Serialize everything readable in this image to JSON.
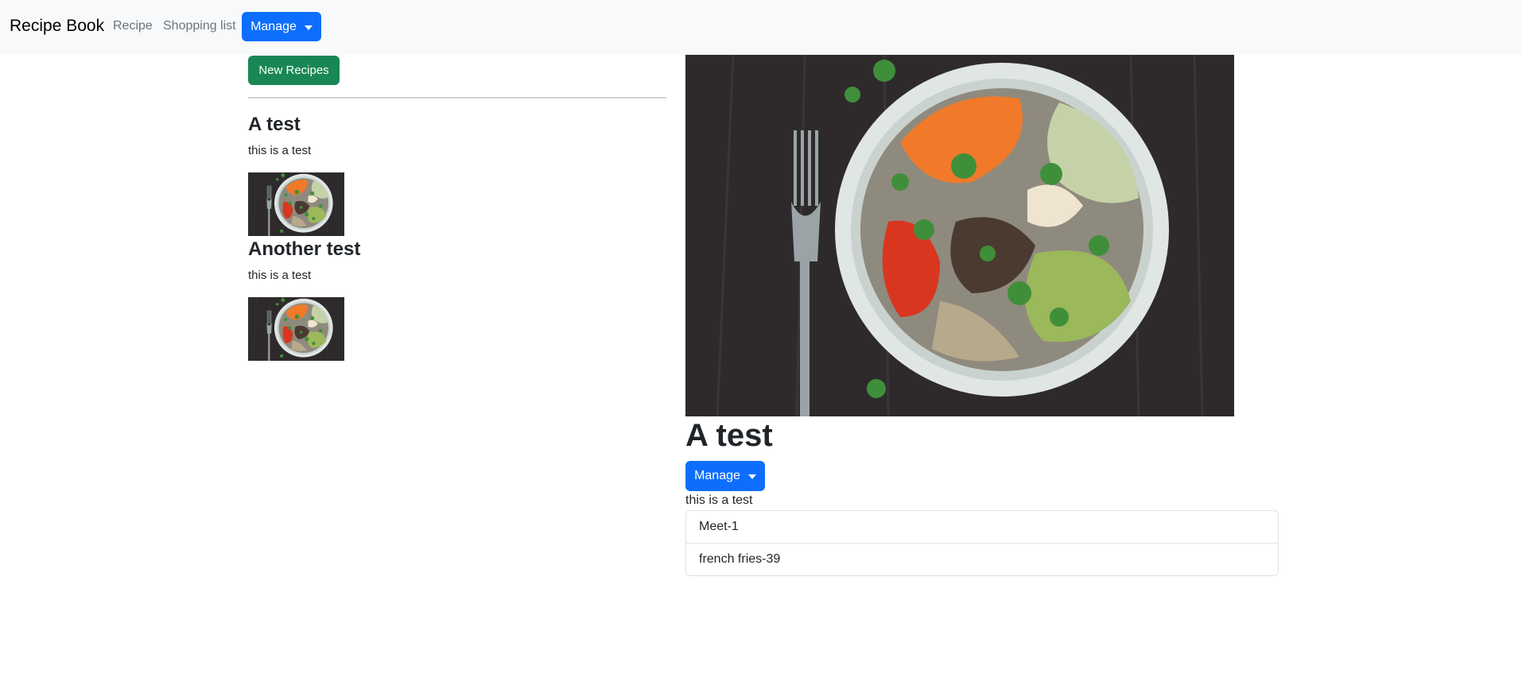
{
  "navbar": {
    "brand": "Recipe Book",
    "links": [
      "Recipe",
      "Shopping list"
    ],
    "manage_label": "Manage"
  },
  "recipe_list": {
    "new_button_label": "New Recipes",
    "items": [
      {
        "title": "A test",
        "description": "this is a test"
      },
      {
        "title": "Another test",
        "description": "this is a test"
      }
    ]
  },
  "recipe_detail": {
    "title": "A test",
    "manage_label": "Manage",
    "description": "this is a test",
    "ingredients": [
      "Meet-1",
      "french fries-39"
    ]
  }
}
